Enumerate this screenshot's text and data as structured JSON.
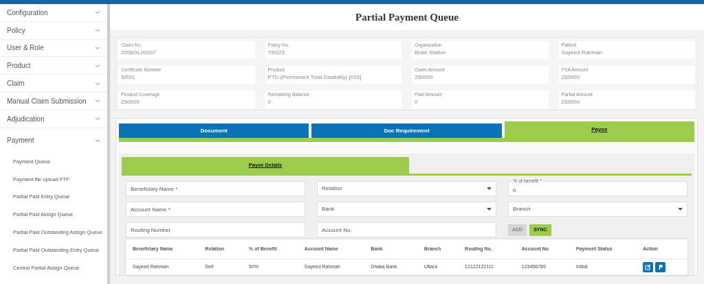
{
  "sidebar": {
    "items": [
      {
        "label": "Configuration",
        "expanded": false
      },
      {
        "label": "Policy",
        "expanded": false
      },
      {
        "label": "User & Role",
        "expanded": false
      },
      {
        "label": "Product",
        "expanded": false
      },
      {
        "label": "Claim",
        "expanded": false
      },
      {
        "label": "Manual Claim Submission",
        "expanded": false
      },
      {
        "label": "Adjudication",
        "expanded": false
      },
      {
        "label": "Payment",
        "expanded": true,
        "children": [
          {
            "label": "Payment Queue"
          },
          {
            "label": "Payment file upload FTP"
          },
          {
            "label": "Partial Paid Entry Queue"
          },
          {
            "label": "Partial Paid Assign Queue"
          },
          {
            "label": "Partial Paid Outstanding Assign Queue"
          },
          {
            "label": "Partial Paid Outstanding Entry Queue"
          },
          {
            "label": "Central Partial Assign Queue"
          }
        ]
      }
    ]
  },
  "page_title": "Partial Payment Queue",
  "claim_info": {
    "fields": [
      {
        "label": "Claim No",
        "value": "2206GL00007"
      },
      {
        "label": "Policy No.",
        "value": "TBS23"
      },
      {
        "label": "Organization",
        "value": "Brain Station"
      },
      {
        "label": "Patient",
        "value": "Sayeed Rahman"
      },
      {
        "label": "Certificate Number",
        "value": "SR01"
      },
      {
        "label": "Product",
        "value": "PTD (Permanent Total Disability) [016]"
      },
      {
        "label": "Claim Amount",
        "value": "250000"
      },
      {
        "label": "FSA Amount",
        "value": "250000"
      },
      {
        "label": "Product Coverage",
        "value": "250000"
      },
      {
        "label": "Remaining Balance",
        "value": "0"
      },
      {
        "label": "Paid Amount",
        "value": "0"
      },
      {
        "label": "Partial Amount",
        "value": "250000"
      }
    ]
  },
  "tabs": [
    {
      "label": "Document",
      "selected": false
    },
    {
      "label": "Doc Requirement",
      "selected": false
    },
    {
      "label": "Payee",
      "selected": true
    }
  ],
  "sub_tabs": [
    {
      "label": "Payee Details",
      "selected": true
    }
  ],
  "payee_form": {
    "fields": [
      {
        "kind": "text",
        "placeholder": "Beneficiary Name *"
      },
      {
        "kind": "select",
        "placeholder": "Relation"
      },
      {
        "kind": "text",
        "label": "% of benefit *",
        "value": "0"
      },
      {
        "kind": "text",
        "placeholder": "Account Name *"
      },
      {
        "kind": "select",
        "placeholder": "Bank"
      },
      {
        "kind": "select",
        "placeholder": "Branch"
      },
      {
        "kind": "text",
        "placeholder": "Routing Number"
      },
      {
        "kind": "text",
        "placeholder": "Account No."
      }
    ],
    "buttons": [
      {
        "label": "ADD",
        "disabled": true
      },
      {
        "label": "SYNC",
        "disabled": false
      }
    ]
  },
  "payee_table": {
    "columns": [
      "Beneficiary Name",
      "Relation",
      "% of Benefit",
      "Account Name",
      "Bank",
      "Branch",
      "Routing No.",
      "Account No",
      "Payment Status",
      "Action"
    ],
    "rows": [
      {
        "cells": [
          "Sayeed Rahman",
          "Self",
          "50%",
          "Sayeed Rahman",
          "Dhaka Bank",
          "Uttara",
          "12122122111",
          "123456789",
          "Initial"
        ]
      }
    ]
  }
}
